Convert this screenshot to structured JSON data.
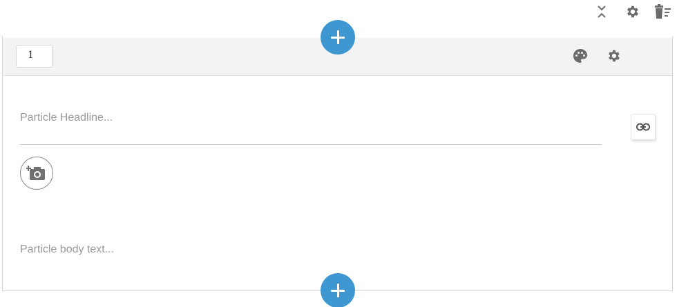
{
  "toolbar": {
    "icons": [
      "collapse-expand-icon",
      "settings-icon",
      "delete-icon"
    ]
  },
  "block": {
    "number": "1",
    "header_icons": [
      "palette-icon",
      "settings-icon"
    ],
    "headline_placeholder": "Particle Headline...",
    "body_placeholder": "Particle body text...",
    "accent_color": "#3f97d1",
    "icon_color": "#6b6b6b"
  }
}
